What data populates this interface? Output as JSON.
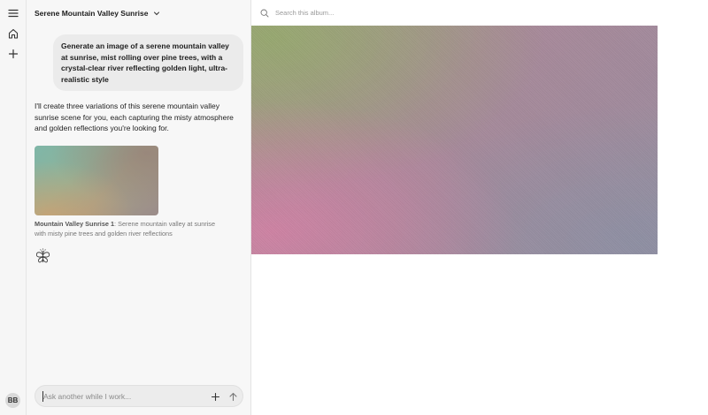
{
  "rail": {
    "menu_icon": "hamburger-menu-icon",
    "home_icon": "home-icon",
    "new_icon": "plus-icon",
    "avatar_initials": "BB"
  },
  "chat": {
    "title": "Serene Mountain Valley Sunrise",
    "user_message": "Generate an image of a serene mountain valley at sunrise, mist rolling over pine trees, with a crystal-clear river reflecting golden light, ultra-realistic style",
    "assistant_message": "I'll create three variations of this serene mountain valley sunrise scene for you, each capturing the misty atmosphere and golden reflections you're looking for.",
    "image_caption_title": "Mountain Valley Sunrise 1",
    "image_caption_text": ": Serene mountain valley at sunrise with misty pine trees and golden river reflections",
    "composer_placeholder": "Ask another while I work..."
  },
  "album": {
    "search_placeholder": "Search this album..."
  }
}
